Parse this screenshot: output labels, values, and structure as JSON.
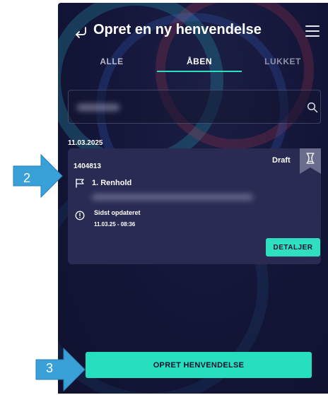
{
  "header": {
    "title": "Opret en ny henvendelse"
  },
  "tabs": [
    {
      "label": "ALLE",
      "active": false
    },
    {
      "label": "ÅBEN",
      "active": true
    },
    {
      "label": "LUKKET",
      "active": false
    }
  ],
  "list": {
    "date": "11.03.2025",
    "cards": [
      {
        "id": "1404813",
        "status": "Draft",
        "task": "1. Renhold",
        "updated_label": "Sidst opdateret",
        "updated_time": "11.03.25 - 08:36",
        "details_label": "DETALJER"
      }
    ]
  },
  "footer": {
    "create_label": "OPRET HENVENDELSE"
  },
  "annotations": [
    {
      "number": "2"
    },
    {
      "number": "3"
    }
  ],
  "colors": {
    "accent": "#2ee0c0",
    "background": "#14163a",
    "card": "#2a2b52",
    "callout": "#3aa0d8"
  },
  "icons": [
    "back-arrow-icon",
    "hamburger-menu-icon",
    "search-icon",
    "hourglass-icon",
    "flag-icon",
    "clock-icon"
  ]
}
